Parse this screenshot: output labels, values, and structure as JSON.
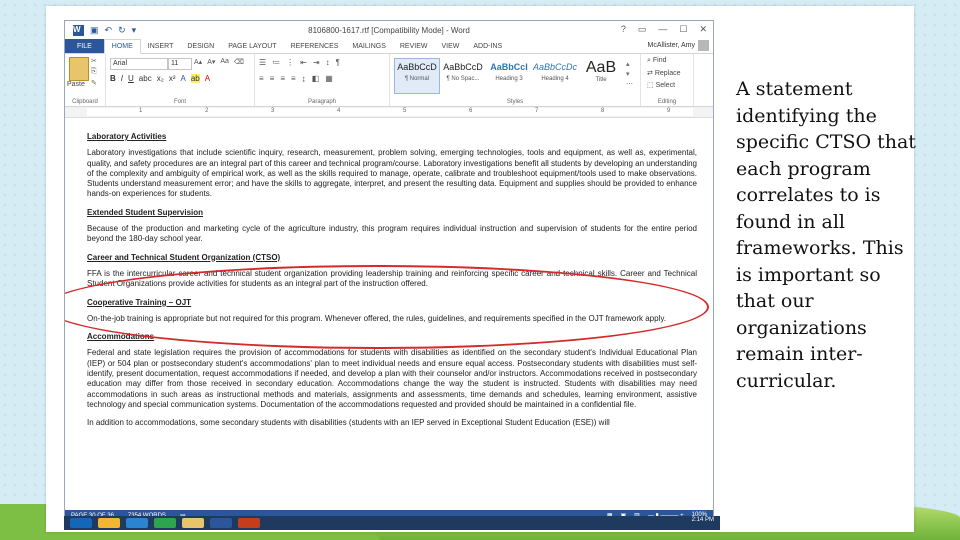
{
  "window": {
    "title": "8106800-1617.rtf [Compatibility Mode] - Word",
    "controls": [
      "?",
      "▭",
      "—",
      "☐",
      "✕"
    ]
  },
  "ribbon_tabs": [
    "FILE",
    "HOME",
    "INSERT",
    "DESIGN",
    "PAGE LAYOUT",
    "REFERENCES",
    "MAILINGS",
    "REVIEW",
    "VIEW",
    "ADD-INS"
  ],
  "user": {
    "name": "McAllister, Amy"
  },
  "clipboard": {
    "paste_label": "Paste",
    "group_label": "Clipboard"
  },
  "font": {
    "name": "Arial",
    "size": "11",
    "group_label": "Font"
  },
  "paragraph": {
    "group_label": "Paragraph"
  },
  "styles": {
    "group_label": "Styles",
    "items": [
      {
        "sample": "AaBbCcD",
        "name": "¶ Normal"
      },
      {
        "sample": "AaBbCcD",
        "name": "¶ No Spac..."
      },
      {
        "sample": "AaBbCcI",
        "name": "Heading 3"
      },
      {
        "sample": "AaBbCcDc",
        "name": "Heading 4"
      },
      {
        "sample": "AaB",
        "name": "Title"
      }
    ]
  },
  "editing": {
    "find": "Find",
    "replace": "Replace",
    "select": "Select",
    "group_label": "Editing"
  },
  "ruler": [
    "1",
    "2",
    "3",
    "4",
    "5",
    "6",
    "7",
    "8",
    "9"
  ],
  "document": {
    "sections": [
      {
        "heading": "Laboratory Activities",
        "body": "Laboratory investigations that include scientific inquiry, research, measurement, problem solving, emerging technologies, tools and equipment, as well as, experimental, quality, and safety procedures are an integral part of this career and technical program/course. Laboratory investigations benefit all students by developing an understanding of the complexity and ambiguity of empirical work, as well as the skills required to manage, operate, calibrate and troubleshoot equipment/tools used to make observations. Students understand measurement error; and have the skills to aggregate, interpret, and present the resulting data. Equipment and supplies should be provided to enhance hands-on experiences for students."
      },
      {
        "heading": "Extended Student Supervision",
        "body": "Because of the production and marketing cycle of the agriculture industry, this program requires individual instruction and supervision of students for the entire period beyond the 180-day school year."
      },
      {
        "heading": "Career and Technical Student Organization (CTSO)",
        "body": "FFA is the intercurricular career and technical student organization providing leadership training and reinforcing specific career and technical skills. Career and Technical Student Organizations provide activities for students as an integral part of the instruction offered."
      },
      {
        "heading": "Cooperative Training – OJT",
        "body": "On-the-job training is appropriate but not required for this program. Whenever offered, the rules, guidelines, and requirements specified in the OJT framework apply."
      },
      {
        "heading": "Accommodations",
        "body": "Federal and state legislation requires the provision of accommodations for students with disabilities as identified on the secondary student's Individual Educational Plan (IEP) or 504 plan or postsecondary student's accommodations' plan to meet individual needs and ensure equal access. Postsecondary students with disabilities must self-identify, present documentation, request accommodations if needed, and develop a plan with their counselor and/or instructors. Accommodations received in postsecondary education may differ from those received in secondary education. Accommodations change the way the student is instructed. Students with disabilities may need accommodations in such areas as instructional methods and materials, assignments and assessments, time demands and schedules, learning environment, assistive technology and special communication systems. Documentation of the accommodations requested and provided should be maintained in a confidential file."
      },
      {
        "heading": "",
        "body": "In addition to accommodations, some secondary students with disabilities (students with an IEP served in Exceptional Student Education (ESE)) will"
      }
    ]
  },
  "status": {
    "page": "PAGE 30 OF 36",
    "words": "7354 WORDS",
    "zoom": "100%"
  },
  "taskbar": {
    "time": "2:14 PM"
  },
  "caption": "A statement identifying the specific CTSO that each program correlates to is found in all frameworks. This is important so that our organizations remain inter-curricular.",
  "colors": {
    "word_blue": "#2b579a",
    "ellipse": "#d42a2a"
  }
}
